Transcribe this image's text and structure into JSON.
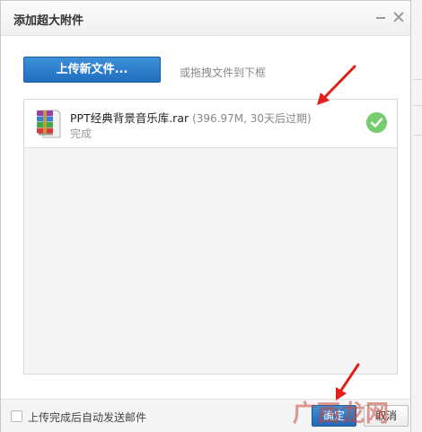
{
  "dialog": {
    "title": "添加超大附件"
  },
  "toolbar": {
    "upload_label": "上传新文件...",
    "drag_hint": "或拖拽文件到下框"
  },
  "files": [
    {
      "name": "PPT经典背景音乐库.rar",
      "meta": "(396.97M, 30天后过期)",
      "status": "完成",
      "icon": "winrar-archive-icon"
    }
  ],
  "footer": {
    "auto_send_label": "上传完成后自动发送邮件",
    "auto_send_checked": false,
    "confirm_label": "确定",
    "cancel_label": "取消"
  },
  "colors": {
    "primary_button": "#1f6fbf",
    "success": "#77cc6f",
    "annotation_arrow": "#e0211a"
  },
  "watermark": "广西龙网"
}
